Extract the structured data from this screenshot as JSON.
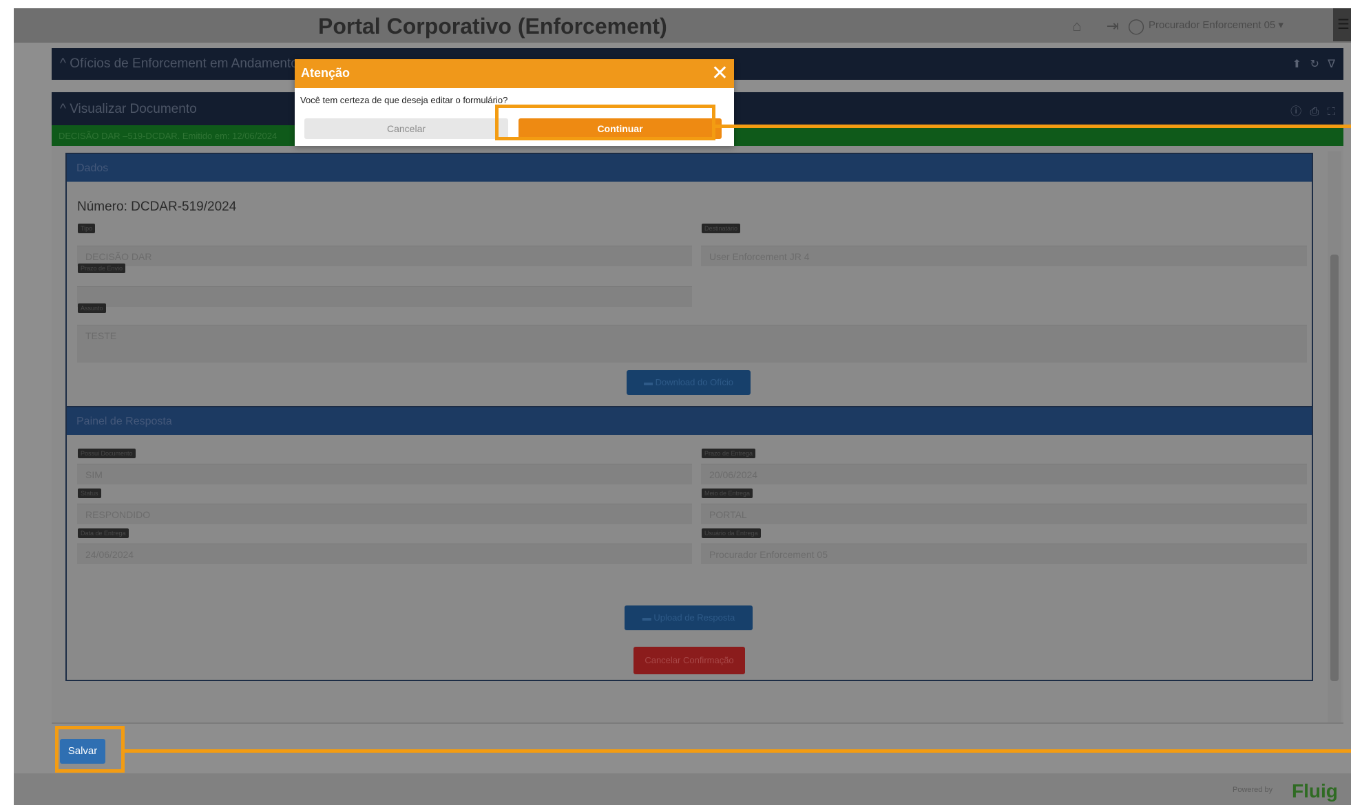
{
  "header": {
    "title": "Portal Corporativo (Enforcement)",
    "user_label": "Procurador Enforcement 05 ▾"
  },
  "panels": {
    "oficios_title": "Ofícios de Enforcement em Andamento",
    "visualizar_title": "Visualizar Documento",
    "doc_status": "DECISÃO DAR –519-DCDAR. Emitido em: 12/06/2024"
  },
  "dados": {
    "section_title": "Dados",
    "numero": "Número: DCDAR-519/2024",
    "tipo_label": "Tipo",
    "tipo_value": "DECISÃO DAR",
    "destinatario_label": "Destinatário",
    "destinatario_value": "User Enforcement JR 4",
    "prazo_label": "Prazo de Envio",
    "prazo_value": "",
    "assunto_label": "Assunto",
    "assunto_value": "TESTE",
    "download_label": "Download do Ofício"
  },
  "resposta": {
    "section_title": "Painel de Resposta",
    "possui_label": "Possui Documento",
    "possui_value": "SIM",
    "data_entrega_label": "Prazo de Entrega",
    "data_entrega_value": "20/06/2024",
    "status_label": "Status",
    "status_value": "RESPONDIDO",
    "meio_label": "Meio de Entrega",
    "meio_value": "PORTAL",
    "data_label": "Data de Entrega",
    "data_value": "24/06/2024",
    "usuario_label": "Usuário da Entrega",
    "usuario_value": "Procurador Enforcement 05",
    "upload_label": "Upload de Resposta",
    "cancel_label": "Cancelar Confirmação"
  },
  "footer": {
    "save_label": "Salvar",
    "powered": "Powered by",
    "brand": "Fluig"
  },
  "modal": {
    "title": "Atenção",
    "close_glyph": "✕",
    "message": "Você tem certeza de que deseja editar o formulário?",
    "cancel_label": "Cancelar",
    "continue_label": "Continuar"
  },
  "icons": {
    "home": "⌂",
    "logout": "⇥",
    "user": "◯",
    "menu": "☰",
    "caret_up": "^",
    "panel_tools_1": "⬆ ↻ ∇",
    "panel_tools_2": "ⓘ ⎙ ⛶",
    "folder": "▬"
  },
  "colors": {
    "accent_orange": "#f39c12",
    "modal_header": "#f0981a",
    "save_button": "#2f6fb2"
  }
}
